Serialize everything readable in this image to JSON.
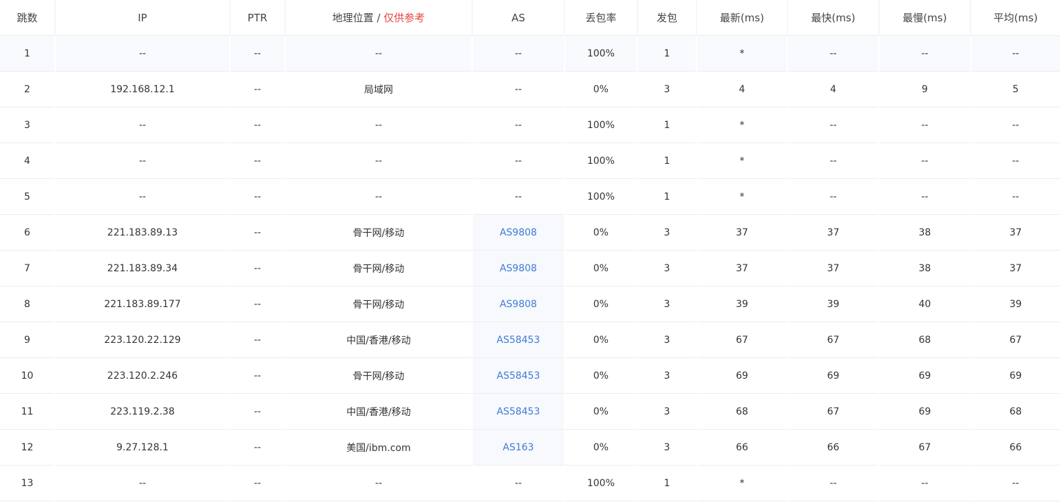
{
  "columns": {
    "hop": "跳数",
    "ip": "IP",
    "ptr": "PTR",
    "geo": "地理位置",
    "geo_sep": " / ",
    "geo_note": "仅供参考",
    "as": "AS",
    "loss": "丢包率",
    "sent": "发包",
    "last": "最新(ms)",
    "best": "最快(ms)",
    "worst": "最慢(ms)",
    "avg": "平均(ms)"
  },
  "rows": [
    {
      "hop": "1",
      "ip": "--",
      "ptr": "--",
      "geo": "--",
      "as": "--",
      "loss": "100%",
      "sent": "1",
      "last": "*",
      "best": "--",
      "worst": "--",
      "avg": "--"
    },
    {
      "hop": "2",
      "ip": "192.168.12.1",
      "ptr": "--",
      "geo": "局域网",
      "as": "--",
      "loss": "0%",
      "sent": "3",
      "last": "4",
      "best": "4",
      "worst": "9",
      "avg": "5"
    },
    {
      "hop": "3",
      "ip": "--",
      "ptr": "--",
      "geo": "--",
      "as": "--",
      "loss": "100%",
      "sent": "1",
      "last": "*",
      "best": "--",
      "worst": "--",
      "avg": "--"
    },
    {
      "hop": "4",
      "ip": "--",
      "ptr": "--",
      "geo": "--",
      "as": "--",
      "loss": "100%",
      "sent": "1",
      "last": "*",
      "best": "--",
      "worst": "--",
      "avg": "--"
    },
    {
      "hop": "5",
      "ip": "--",
      "ptr": "--",
      "geo": "--",
      "as": "--",
      "loss": "100%",
      "sent": "1",
      "last": "*",
      "best": "--",
      "worst": "--",
      "avg": "--"
    },
    {
      "hop": "6",
      "ip": "221.183.89.13",
      "ptr": "--",
      "geo": "骨干网/移动",
      "as": "AS9808",
      "loss": "0%",
      "sent": "3",
      "last": "37",
      "best": "37",
      "worst": "38",
      "avg": "37"
    },
    {
      "hop": "7",
      "ip": "221.183.89.34",
      "ptr": "--",
      "geo": "骨干网/移动",
      "as": "AS9808",
      "loss": "0%",
      "sent": "3",
      "last": "37",
      "best": "37",
      "worst": "38",
      "avg": "37"
    },
    {
      "hop": "8",
      "ip": "221.183.89.177",
      "ptr": "--",
      "geo": "骨干网/移动",
      "as": "AS9808",
      "loss": "0%",
      "sent": "3",
      "last": "39",
      "best": "39",
      "worst": "40",
      "avg": "39"
    },
    {
      "hop": "9",
      "ip": "223.120.22.129",
      "ptr": "--",
      "geo": "中国/香港/移动",
      "as": "AS58453",
      "loss": "0%",
      "sent": "3",
      "last": "67",
      "best": "67",
      "worst": "68",
      "avg": "67"
    },
    {
      "hop": "10",
      "ip": "223.120.2.246",
      "ptr": "--",
      "geo": "骨干网/移动",
      "as": "AS58453",
      "loss": "0%",
      "sent": "3",
      "last": "69",
      "best": "69",
      "worst": "69",
      "avg": "69"
    },
    {
      "hop": "11",
      "ip": "223.119.2.38",
      "ptr": "--",
      "geo": "中国/香港/移动",
      "as": "AS58453",
      "loss": "0%",
      "sent": "3",
      "last": "68",
      "best": "67",
      "worst": "69",
      "avg": "68"
    },
    {
      "hop": "12",
      "ip": "9.27.128.1",
      "ptr": "--",
      "geo": "美国/ibm.com",
      "as": "AS163",
      "loss": "0%",
      "sent": "3",
      "last": "66",
      "best": "66",
      "worst": "67",
      "avg": "66"
    },
    {
      "hop": "13",
      "ip": "--",
      "ptr": "--",
      "geo": "--",
      "as": "--",
      "loss": "100%",
      "sent": "1",
      "last": "*",
      "best": "--",
      "worst": "--",
      "avg": "--"
    }
  ],
  "colors": {
    "link": "#3e7bd8",
    "note": "#e64340",
    "text": "#333333",
    "first_row_bg": "#f9fafe",
    "as_cell_bg": "#f7f9fc",
    "row_border": "#ececec"
  }
}
